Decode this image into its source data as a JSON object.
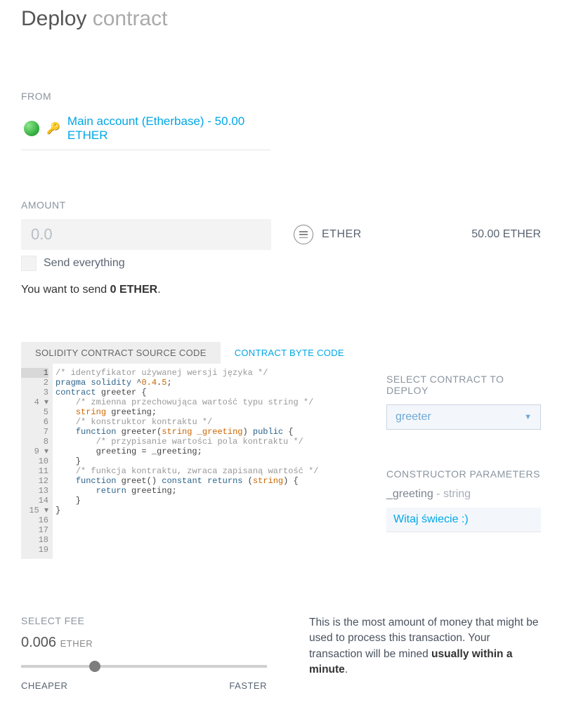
{
  "page": {
    "title_bold": "Deploy",
    "title_rest": "contract"
  },
  "from": {
    "label": "FROM",
    "account_text": "Main account (Etherbase) - 50.00 ETHER"
  },
  "amount": {
    "label": "AMOUNT",
    "placeholder": "0.0",
    "currency": "ETHER",
    "balance": "50.00 ETHER",
    "send_everything": "Send everything",
    "you_want_prefix": "You want to send ",
    "you_want_value": "0 ETHER",
    "you_want_suffix": "."
  },
  "tabs": {
    "source": "SOLIDITY CONTRACT SOURCE CODE",
    "bytecode": "CONTRACT BYTE CODE"
  },
  "code": {
    "lines": [
      {
        "n": "1",
        "arrow": "",
        "text_com": "/* identyfikator używanej wersji języka */"
      },
      {
        "n": "2",
        "arrow": "",
        "text_pragma": "pragma solidity ^0.4.5;"
      },
      {
        "n": "3",
        "arrow": "",
        "text_plain": ""
      },
      {
        "n": "4",
        "arrow": "▾",
        "text_contract": "contract greeter {"
      },
      {
        "n": "5",
        "arrow": "",
        "text_com_indent": "    /* zmienna przechowująca wartość typu string */"
      },
      {
        "n": "6",
        "arrow": "",
        "text_decl": "    string greeting;"
      },
      {
        "n": "7",
        "arrow": "",
        "text_plain": ""
      },
      {
        "n": "8",
        "arrow": "",
        "text_com_indent": "    /* konstruktor kontraktu */"
      },
      {
        "n": "9",
        "arrow": "▾",
        "text_fn1": "    function greeter(string _greeting) public {"
      },
      {
        "n": "10",
        "arrow": "",
        "text_com_indent2": "        /* przypisanie wartości pola kontraktu */"
      },
      {
        "n": "11",
        "arrow": "",
        "text_assign": "        greeting = _greeting;"
      },
      {
        "n": "12",
        "arrow": "",
        "text_plain": "    }"
      },
      {
        "n": "13",
        "arrow": "",
        "text_plain": ""
      },
      {
        "n": "14",
        "arrow": "",
        "text_com_indent": "    /* funkcja kontraktu, zwraca zapisaną wartość */"
      },
      {
        "n": "15",
        "arrow": "▾",
        "text_fn2": "    function greet() constant returns (string) {"
      },
      {
        "n": "16",
        "arrow": "",
        "text_return": "        return greeting;"
      },
      {
        "n": "17",
        "arrow": "",
        "text_plain": "    }"
      },
      {
        "n": "18",
        "arrow": "",
        "text_plain": "}"
      },
      {
        "n": "19",
        "arrow": "",
        "text_plain": ""
      }
    ]
  },
  "deploy": {
    "select_label": "SELECT CONTRACT TO DEPLOY",
    "selected": "greeter",
    "params_label": "CONSTRUCTOR PARAMETERS",
    "param_name": "_greeting",
    "param_type": " - string",
    "param_value": "Witaj świecie :)"
  },
  "fee": {
    "label": "SELECT FEE",
    "value": "0.006",
    "unit": "ETHER",
    "slider_position_pct": 30,
    "cheaper": "CHEAPER",
    "faster": "FASTER",
    "desc_prefix": "This is the most amount of money that might be used to process this transaction. Your transaction will be mined ",
    "desc_bold": "usually within a minute",
    "desc_suffix": "."
  }
}
